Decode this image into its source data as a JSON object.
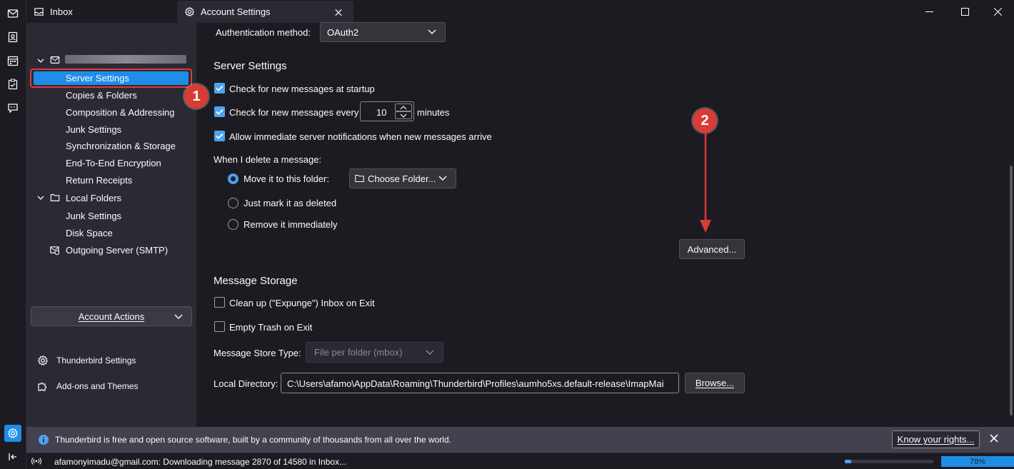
{
  "tabs": [
    {
      "label": "Inbox",
      "icon": "inbox-icon"
    },
    {
      "label": "Account Settings",
      "icon": "gear-icon"
    }
  ],
  "tree": {
    "account_name": "",
    "items": [
      {
        "label": "Server Settings",
        "selected": true
      },
      {
        "label": "Copies & Folders"
      },
      {
        "label": "Composition & Addressing"
      },
      {
        "label": "Junk Settings"
      },
      {
        "label": "Synchronization & Storage"
      },
      {
        "label": "End-To-End Encryption"
      },
      {
        "label": "Return Receipts"
      }
    ],
    "local_folders": {
      "label": "Local Folders",
      "items": [
        {
          "label": "Junk Settings"
        },
        {
          "label": "Disk Space"
        }
      ]
    },
    "outgoing": "Outgoing Server (SMTP)",
    "account_actions": "Account Actions",
    "footer": {
      "settings": "Thunderbird Settings",
      "addons": "Add-ons and Themes"
    }
  },
  "main": {
    "auth_label": "Authentication method:",
    "auth_value": "OAuth2",
    "server_settings_title": "Server Settings",
    "check_startup": "Check for new messages at startup",
    "check_every": "Check for new messages every",
    "check_every_value": "10",
    "minutes": "minutes",
    "allow_notifications": "Allow immediate server notifications when new messages arrive",
    "delete_label": "When I delete a message:",
    "move_to_folder": "Move it to this folder:",
    "choose_folder": "Choose Folder...",
    "mark_deleted": "Just mark it as deleted",
    "remove_immediately": "Remove it immediately",
    "advanced": "Advanced...",
    "storage_title": "Message Storage",
    "cleanup": "Clean up (\"Expunge\") Inbox on Exit",
    "empty_trash": "Empty Trash on Exit",
    "store_type_label": "Message Store Type:",
    "store_type_value": "File per folder (mbox)",
    "local_dir_label": "Local Directory:",
    "local_dir_value": "C:\\Users\\afamo\\AppData\\Roaming\\Thunderbird\\Profiles\\aumho5xs.default-release\\ImapMai",
    "browse": "Browse..."
  },
  "notification": {
    "text": "Thunderbird is free and open source software, built by a community of thousands from all over the world.",
    "button": "Know your rights..."
  },
  "status": {
    "text": "afamonyimadu@gmail.com: Downloading message 2870 of 14580 in Inbox...",
    "zoom": "78%",
    "progress": 0.07
  },
  "annotations": {
    "badge1": "1",
    "badge2": "2"
  },
  "colors": {
    "accent": "#4ea2f0",
    "selection": "#1f8de8",
    "badge": "#d93b35"
  }
}
